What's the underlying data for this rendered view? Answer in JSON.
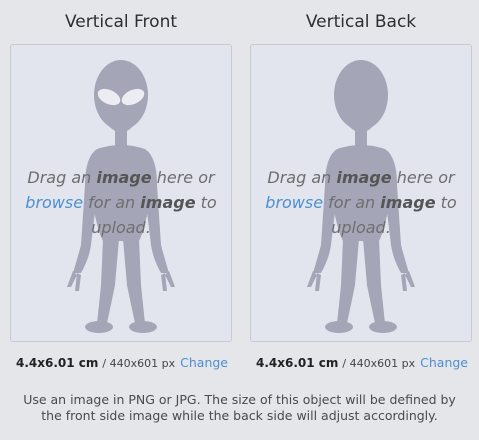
{
  "panels": [
    {
      "title": "Vertical Front",
      "drop_prefix": "Drag an ",
      "drop_image1": "image",
      "drop_mid": " here or ",
      "browse": "browse",
      "drop_for": " for an ",
      "drop_image2": "image",
      "drop_suffix": " to upload.",
      "size_cm": "4.4x6.01 cm",
      "size_px": "/ 440x601 px",
      "change": "Change",
      "figure_icon": "alien-front-placeholder-icon"
    },
    {
      "title": "Vertical Back",
      "drop_prefix": "Drag an ",
      "drop_image1": "image",
      "drop_mid": " here or ",
      "browse": "browse",
      "drop_for": " for an ",
      "drop_image2": "image",
      "drop_suffix": " to upload.",
      "size_cm": "4.4x6.01 cm",
      "size_px": "/ 440x601 px",
      "change": "Change",
      "figure_icon": "alien-back-placeholder-icon"
    }
  ],
  "help_text": "Use an image in PNG or JPG. The size of this object will be defined by the front side image while the back side will adjust accordingly.",
  "colors": {
    "background": "#e4e6ea",
    "dropzone": "#e3e5ee",
    "figure": "#a4a6b8",
    "link": "#4d8fcf"
  }
}
